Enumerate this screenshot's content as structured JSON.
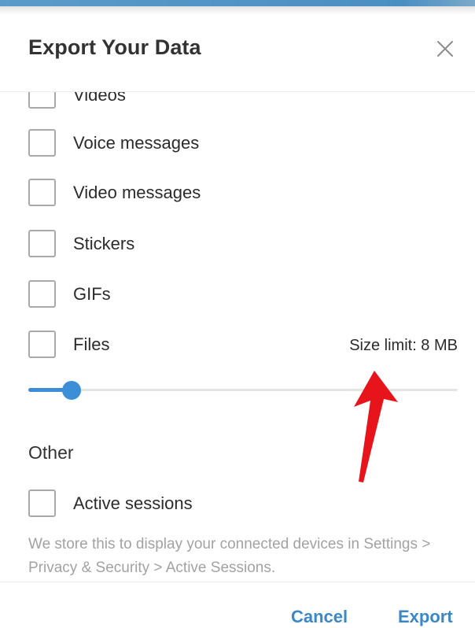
{
  "dialog": {
    "title": "Export Your Data",
    "close_icon": "close-icon"
  },
  "media_types": [
    {
      "label": "Videos",
      "checked": false
    },
    {
      "label": "Voice messages",
      "checked": false
    },
    {
      "label": "Video messages",
      "checked": false
    },
    {
      "label": "Stickers",
      "checked": false
    },
    {
      "label": "GIFs",
      "checked": false
    },
    {
      "label": "Files",
      "checked": false
    }
  ],
  "files_size": {
    "label": "Size limit: 8 MB",
    "slider_value_fraction": 0.1
  },
  "other": {
    "section_title": "Other",
    "active_sessions_label": "Active sessions",
    "active_sessions_checked": false,
    "info_text": "We store this to display your connected devices in Settings > Privacy & Security > Active Sessions."
  },
  "footer": {
    "cancel_label": "Cancel",
    "export_label": "Export"
  },
  "colors": {
    "accent": "#3c8fd6",
    "annotation_arrow": "#e8141b"
  }
}
